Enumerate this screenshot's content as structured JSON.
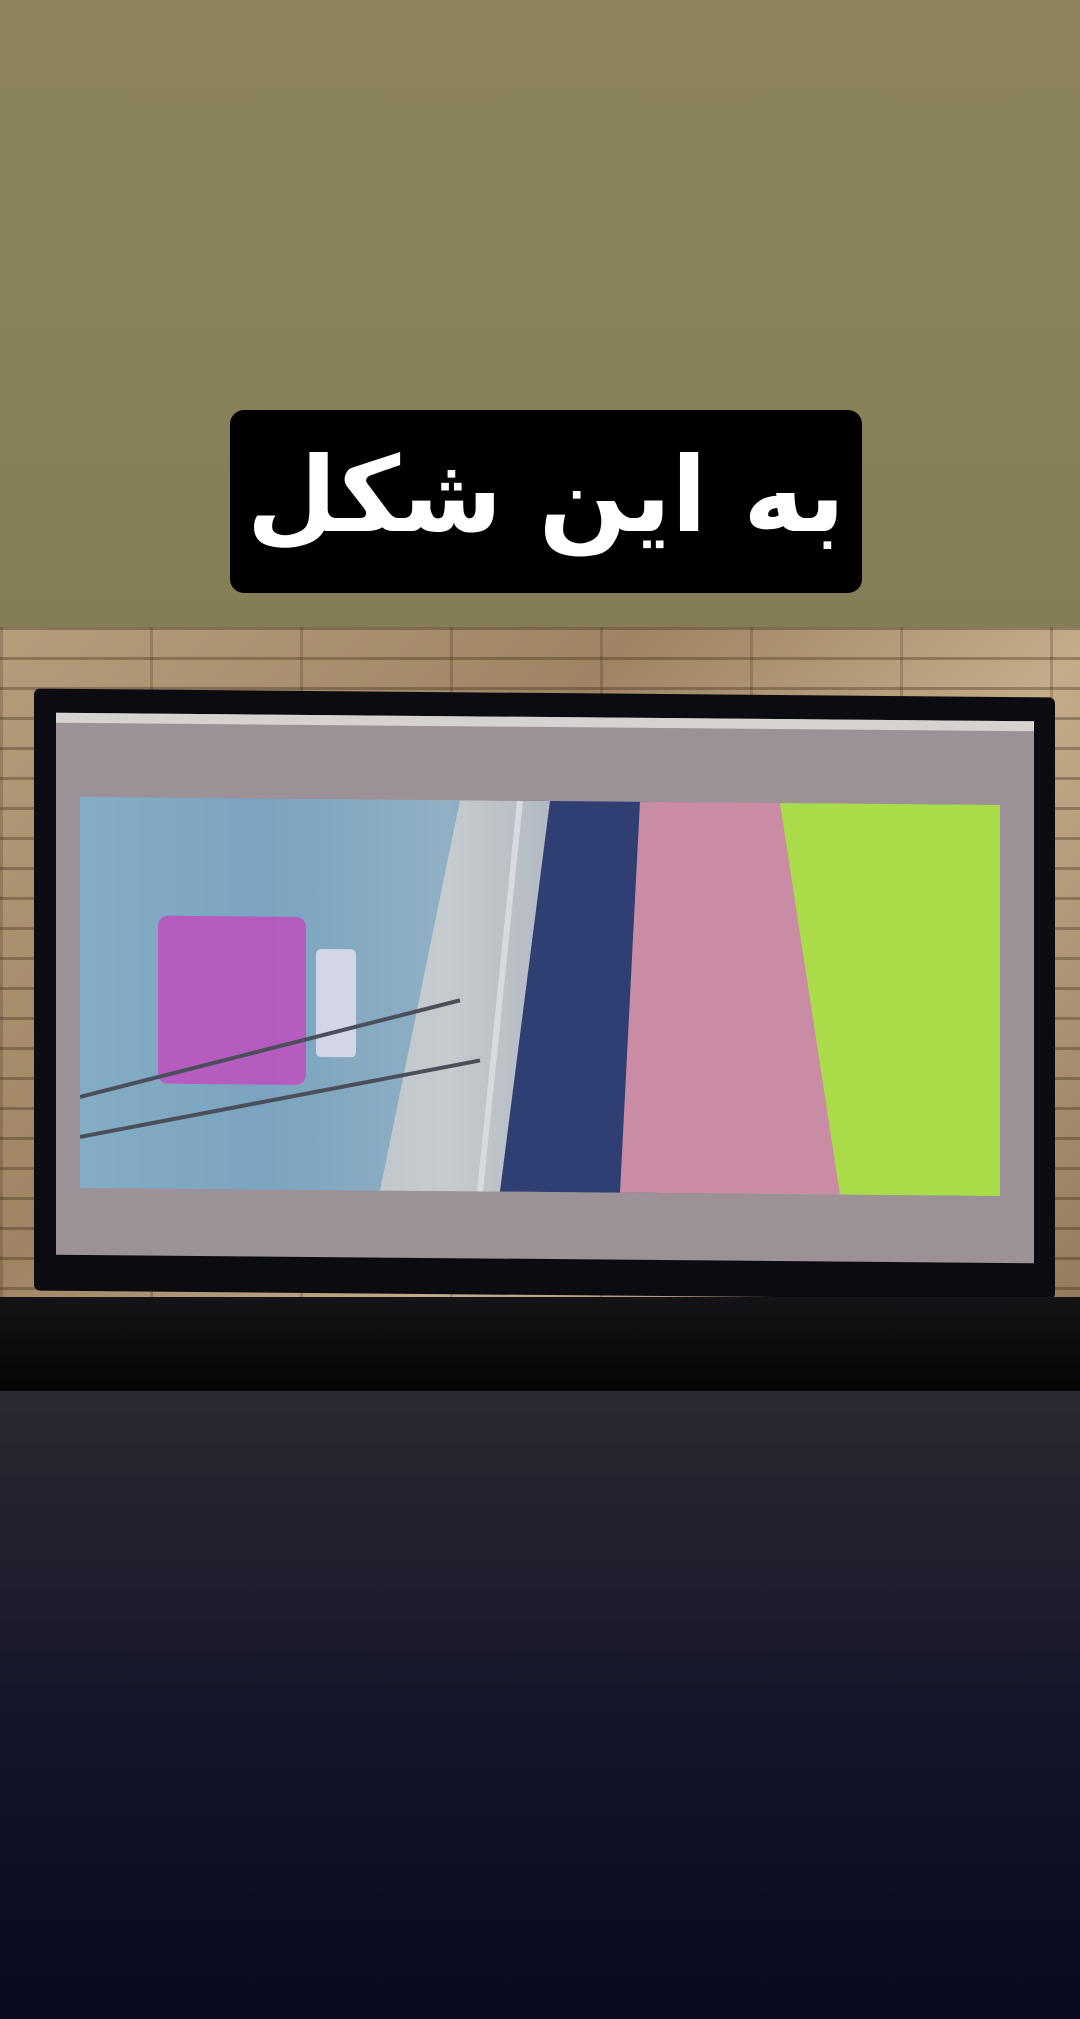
{
  "caption": {
    "text": "به این شکل"
  },
  "photo": {
    "subject": "tv-showing-stadium-stream"
  },
  "colors": {
    "top_background": "#8a8258",
    "caption_box": "#000000",
    "caption_text": "#ffffff",
    "bottom_background": "#0a0a1e"
  }
}
